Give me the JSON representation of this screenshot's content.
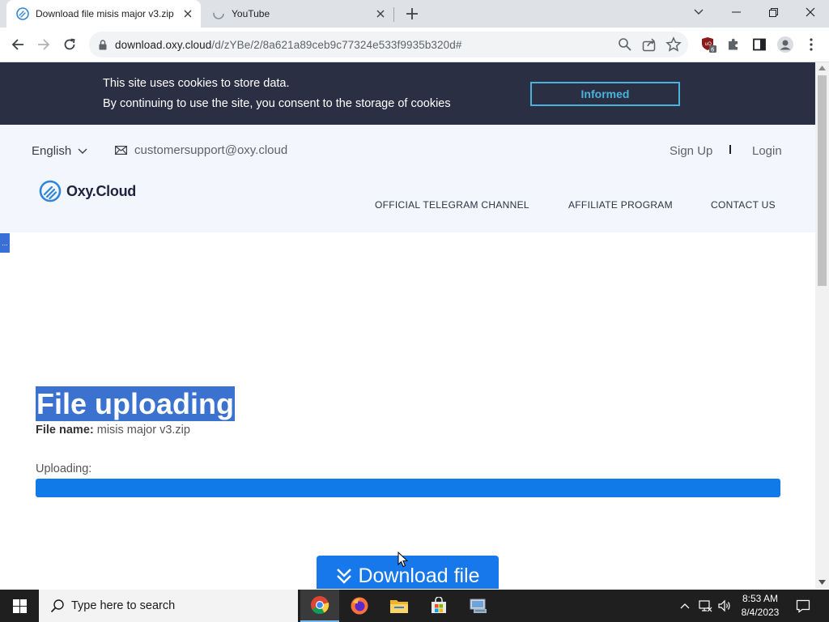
{
  "browser": {
    "tabs": [
      {
        "title": "Download file misis major v3.zip",
        "active": true
      },
      {
        "title": "YouTube",
        "active": false
      }
    ],
    "url_host": "download.oxy.cloud",
    "url_path": "/d/zYBe/2/8a621a89ceb9c77324e533f9935b320d#",
    "extension_badge": "6"
  },
  "cookie_banner": {
    "line1": "This site uses cookies to store data.",
    "line2": "By continuing to use the site, you consent to the storage of cookies",
    "button": "Informed"
  },
  "header": {
    "language": "English",
    "email": "customersupport@oxy.cloud",
    "sign_up": "Sign Up",
    "login": "Login",
    "logo_text": "Oxy.Cloud",
    "nav": [
      "OFFICIAL TELEGRAM CHANNEL",
      "AFFILIATE PROGRAM",
      "CONTACT US"
    ]
  },
  "side_tab": "...",
  "main": {
    "heading": "File uploading",
    "file_name_label": "File name:",
    "file_name": "misis major v3.zip",
    "uploading_label": "Uploading:",
    "progress_fraction": 1.0,
    "download_button": "Download file"
  },
  "taskbar": {
    "search_placeholder": "Type here to search",
    "time": "8:53 AM",
    "date": "8/4/2023"
  },
  "colors": {
    "cookie_bg": "#2b2f44",
    "accent": "#1678ea",
    "informed": "#4ab3dc"
  }
}
